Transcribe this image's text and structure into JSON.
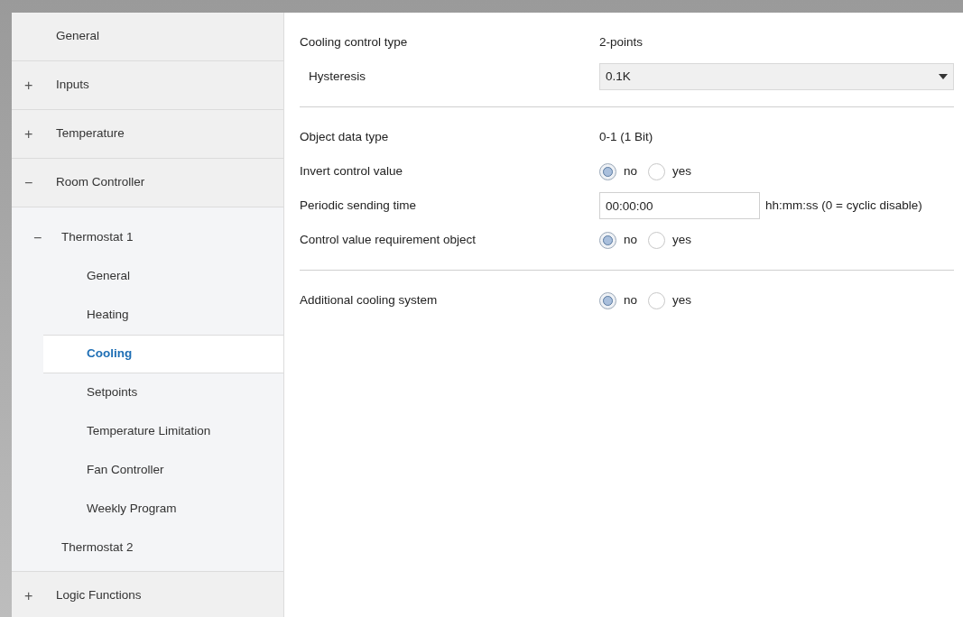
{
  "sidebar": {
    "items": [
      {
        "label": "General",
        "selected": false
      },
      {
        "label": "Inputs",
        "toggle": "+",
        "selected": false
      },
      {
        "label": "Temperature",
        "toggle": "+",
        "selected": false
      },
      {
        "label": "Room Controller",
        "toggle": "−",
        "selected": false,
        "children": [
          {
            "label": "Thermostat 1",
            "toggle": "−",
            "selected": false,
            "children": [
              {
                "label": "General",
                "selected": false
              },
              {
                "label": "Heating",
                "selected": false
              },
              {
                "label": "Cooling",
                "selected": true
              },
              {
                "label": "Setpoints",
                "selected": false
              },
              {
                "label": "Temperature Limitation",
                "selected": false
              },
              {
                "label": "Fan Controller",
                "selected": false
              },
              {
                "label": "Weekly Program",
                "selected": false
              }
            ]
          },
          {
            "label": "Thermostat 2",
            "selected": false
          }
        ]
      },
      {
        "label": "Logic Functions",
        "toggle": "+",
        "selected": false
      }
    ]
  },
  "parameters": [
    {
      "kind": "text",
      "label": "Cooling control type",
      "sub": false,
      "value": "2-points"
    },
    {
      "kind": "dropdown",
      "label": "Hysteresis",
      "sub": true,
      "value": "0.1K"
    },
    {
      "kind": "divider"
    },
    {
      "kind": "text",
      "label": "Object data type",
      "sub": false,
      "value": "0-1 (1 Bit)"
    },
    {
      "kind": "radio",
      "label": "Invert control value",
      "sub": false,
      "options": [
        {
          "label": "no",
          "selected": true
        },
        {
          "label": "yes",
          "selected": false
        }
      ]
    },
    {
      "kind": "input",
      "label": "Periodic sending time",
      "sub": false,
      "value": "00:00:00",
      "unit": "hh:mm:ss (0 = cyclic disable)"
    },
    {
      "kind": "radio",
      "label": "Control value requirement object",
      "sub": false,
      "options": [
        {
          "label": "no",
          "selected": true
        },
        {
          "label": "yes",
          "selected": false
        }
      ]
    },
    {
      "kind": "divider"
    },
    {
      "kind": "radio",
      "label": "Additional cooling system",
      "sub": false,
      "options": [
        {
          "label": "no",
          "selected": true
        },
        {
          "label": "yes",
          "selected": false
        }
      ]
    }
  ]
}
